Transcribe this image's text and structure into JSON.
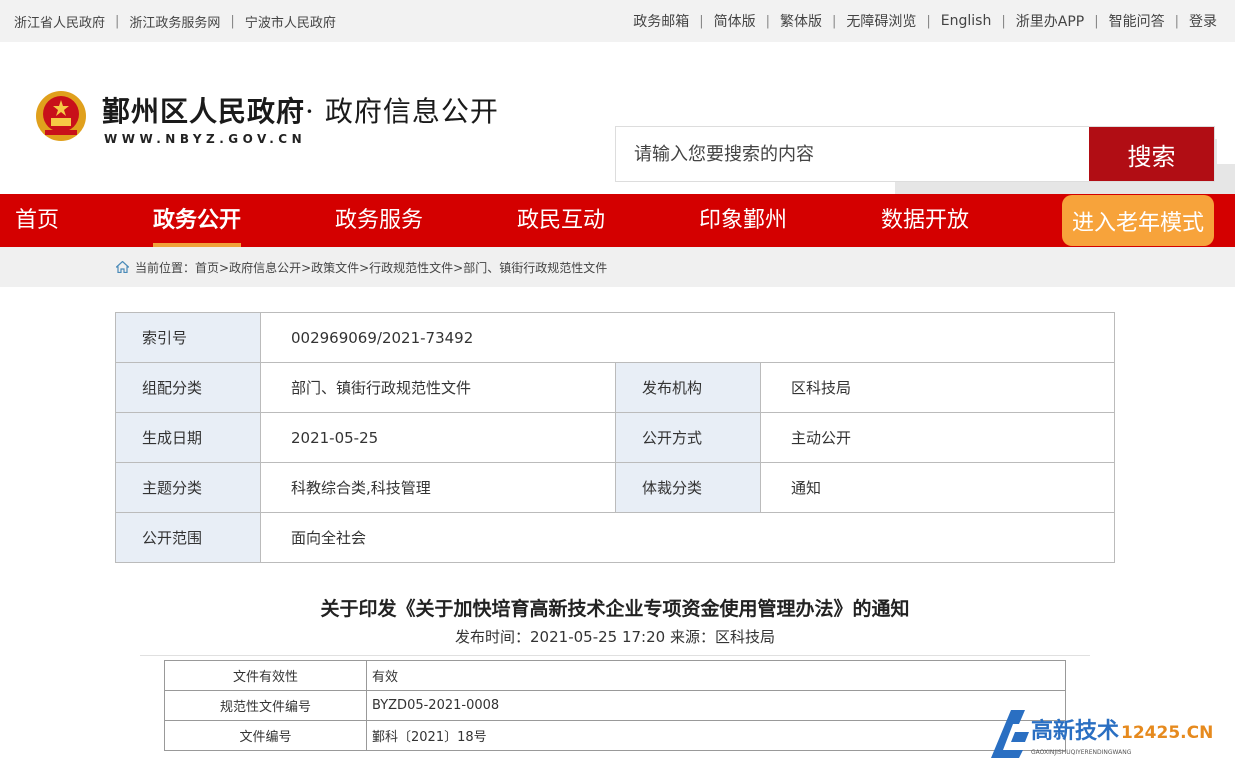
{
  "topbar": {
    "left_links": [
      "浙江省人民政府",
      "浙江政务服务网",
      "宁波市人民政府"
    ],
    "right_links": [
      "政务邮箱",
      "简体版",
      "繁体版",
      "无障碍浏览",
      "English",
      "浙里办APP",
      "智能问答",
      "登录"
    ]
  },
  "header": {
    "title_main": "鄞州区人民政府",
    "title_sub": "· 政府信息公开",
    "url": "WWW.NBYZ.GOV.CN",
    "search_placeholder": "请输入您要搜索的内容",
    "search_button": "搜索"
  },
  "nav": {
    "items": [
      "首页",
      "政务公开",
      "政务服务",
      "政民互动",
      "印象鄞州",
      "数据开放"
    ],
    "elder_mode": "进入老年模式",
    "colors": {
      "bar": "#d40000",
      "elder": "#f7a33b",
      "active_underline": "#f0a23a"
    }
  },
  "breadcrumb": {
    "label": "当前位置：",
    "path": "首页>政府信息公开>政策文件>行政规范性文件>部门、镇街行政规范性文件"
  },
  "meta": {
    "index_label": "索引号",
    "index_value": "002969069/2021-73492",
    "category_label": "组配分类",
    "category_value": "部门、镇街行政规范性文件",
    "org_label": "发布机构",
    "org_value": "区科技局",
    "date_label": "生成日期",
    "date_value": "2021-05-25",
    "method_label": "公开方式",
    "method_value": "主动公开",
    "topic_label": "主题分类",
    "topic_value": "科教综合类,科技管理",
    "genre_label": "体裁分类",
    "genre_value": "通知",
    "scope_label": "公开范围",
    "scope_value": "面向全社会"
  },
  "document": {
    "title": "关于印发《关于加快培育高新技术企业专项资金使用管理办法》的通知",
    "publish_info": "发布时间：2021-05-25 17:20 来源：区科技局"
  },
  "properties": [
    {
      "label": "文件有效性",
      "value": "有效"
    },
    {
      "label": "规范性文件编号",
      "value": "BYZD05-2021-0008"
    },
    {
      "label": "文件编号",
      "value": "鄞科〔2021〕18号"
    }
  ],
  "watermark": {
    "text": "高新技术",
    "domain": "12425.CN",
    "pinyin": "GAOXINJISHUQIYERENDINGWANG"
  }
}
